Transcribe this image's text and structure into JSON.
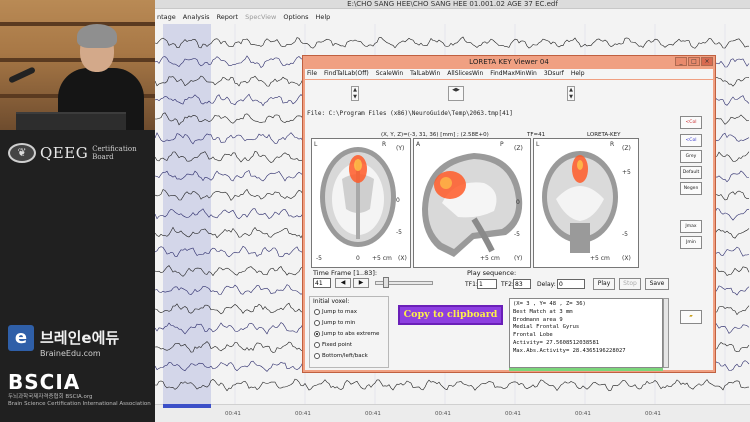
{
  "colors": {
    "loreta_frame": "#f0a082",
    "copy_button_bg": "#8d3fe0",
    "copy_button_text": "#fff04a",
    "highlight_band": "#828cd2",
    "activation": "#ff5a28",
    "side_red_text": "#c8282a",
    "side_blue_text": "#3232c8"
  },
  "branding": {
    "qeeg_name": "QEEG",
    "qeeg_sub": "Certification Board",
    "brainedu_letter": "e",
    "brainedu_kr": "브레인e에듀",
    "brainedu_url": "BraineEdu.com",
    "bscia": "BSCIA",
    "bscia_sub_kr": "두뇌과학국제자격증협회  BSCIA.org",
    "bscia_sub_en": "Brain Science Certification International Association"
  },
  "eeg": {
    "title": "E:\\CHO SANG HEE\\CHO SANG HEE 01.001.02 AGE 37  EC.edf",
    "menu": [
      {
        "label": "ntage",
        "dim": false
      },
      {
        "label": "Analysis",
        "dim": false
      },
      {
        "label": "Report",
        "dim": false
      },
      {
        "label": "SpecView",
        "dim": true
      },
      {
        "label": "Options",
        "dim": false
      },
      {
        "label": "Help",
        "dim": false
      }
    ],
    "time_ticks": [
      "00:41",
      "00:41",
      "00:41",
      "00:41",
      "00:41",
      "00:41",
      "00:41"
    ]
  },
  "loreta": {
    "title": "LORETA KEY Viewer 04",
    "window_buttons": [
      "_",
      "□",
      "×"
    ],
    "menu": [
      "File",
      "FindTalLab(Off)",
      "ScaleWin",
      "TalLabWin",
      "AllSlicesWin",
      "FindMaxMinWin",
      "3Dsurf",
      "Help"
    ],
    "file_path": "File: C:\\Program Files (x86)\\NeuroGuide\\Temp\\2063.tmp[41]",
    "coords": "(X, Y, Z)=(-3, 31, 36) [mm] ; (2.58E+0)",
    "tf": "TF=41",
    "loreta_key": "LORETA-KEY",
    "view_labels": {
      "axial": {
        "l": "L",
        "r": "R",
        "y": "(Y)",
        "scale": "+5 cm",
        "x": "(X)",
        "minus": "-5",
        "zero": "0",
        "plus": "+5"
      },
      "sagittal": {
        "a": "A",
        "p": "P",
        "z": "(Z)",
        "zero": "0",
        "minus": "-5",
        "scale": "+5 cm",
        "y": "(Y)"
      },
      "coronal": {
        "l": "L",
        "r": "R",
        "z": "(Z)",
        "plus": "+5",
        "minus": "-5",
        "scale": "+5 cm",
        "x": "(X)"
      }
    },
    "side_buttons": [
      {
        "label": "<Col",
        "color": "red"
      },
      {
        "label": "<Col",
        "color": "blue"
      },
      {
        "label": "Grey",
        "color": "black"
      },
      {
        "label": "Default",
        "color": "black"
      },
      {
        "label": "Negen",
        "color": "black"
      },
      {
        "label": "Jmax",
        "color": "black"
      },
      {
        "label": "Jmin",
        "color": "black"
      }
    ],
    "time_frame": {
      "label": "Time Frame [1..83]:",
      "value": "41",
      "prev": "◀",
      "next": "▶"
    },
    "play_sequence": {
      "label": "Play sequence:",
      "tf1_label": "TF1:",
      "tf1": "1",
      "tf2_label": "TF2:",
      "tf2": "83",
      "delay_label": "Delay:",
      "delay": "0"
    },
    "play_label": "Play",
    "stop_label": "Stop",
    "save_label": "Save",
    "initial_voxel": {
      "label": "Initial voxel:",
      "options": [
        {
          "label": "Jump to max",
          "selected": false
        },
        {
          "label": "Jump to min",
          "selected": false
        },
        {
          "label": "Jump to abs extreme",
          "selected": true
        },
        {
          "label": "Fixed point",
          "selected": false
        },
        {
          "label": "Bottom/left/back",
          "selected": false
        }
      ]
    },
    "copy_label": "Copy to clipboard",
    "info_lines": [
      "(X= 3 , Y= 48 , Z= 36)",
      "Best Match at 3 mm",
      "Brodmann area 9",
      "Medial Frontal Gyrus",
      "Frontal Lobe",
      "Activity= 27.5608512038581",
      "Max.Abs.Activity= 28.4365196228027"
    ]
  }
}
